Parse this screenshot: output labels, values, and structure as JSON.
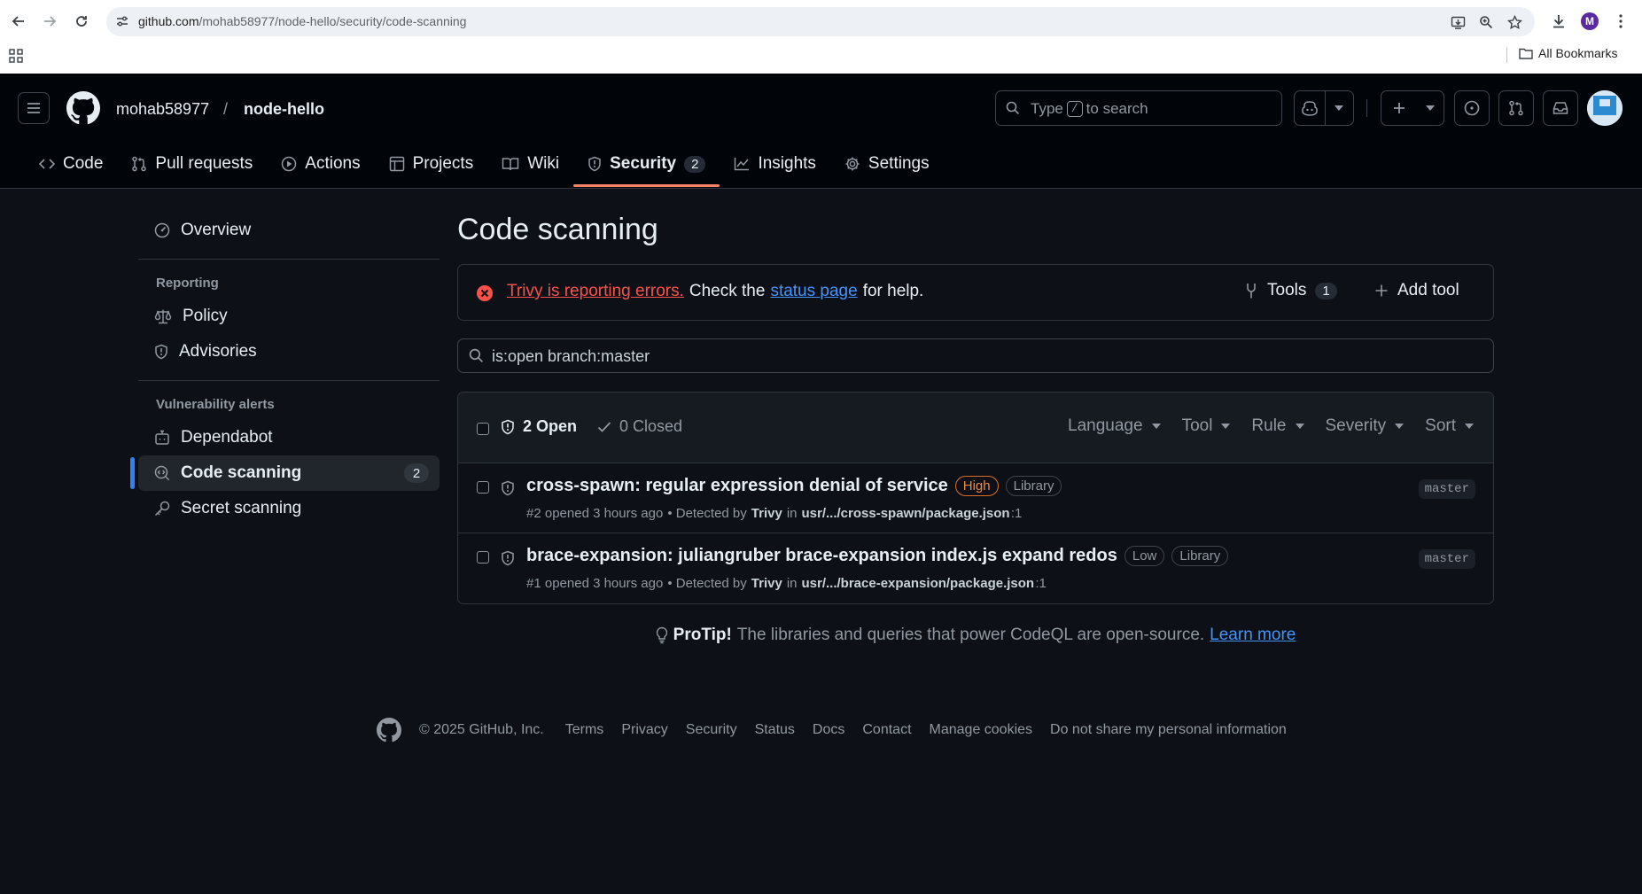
{
  "browser": {
    "url_host": "github.com",
    "url_path": "/mohab58977/node-hello/security/code-scanning",
    "profile_initial": "M",
    "bookmarks_label": "All Bookmarks"
  },
  "header": {
    "owner": "mohab58977",
    "separator": "/",
    "repo": "node-hello",
    "search_type": "Type",
    "search_key": "/",
    "search_suffix": "to search"
  },
  "repo_nav": {
    "tabs": [
      {
        "label": "Code",
        "icon": "code-icon"
      },
      {
        "label": "Pull requests",
        "icon": "git-pull-request-icon"
      },
      {
        "label": "Actions",
        "icon": "play-icon"
      },
      {
        "label": "Projects",
        "icon": "table-icon"
      },
      {
        "label": "Wiki",
        "icon": "book-icon"
      },
      {
        "label": "Security",
        "icon": "shield-icon",
        "counter": "2",
        "active": true
      },
      {
        "label": "Insights",
        "icon": "graph-icon"
      },
      {
        "label": "Settings",
        "icon": "gear-icon"
      }
    ]
  },
  "sidebar": {
    "overview": "Overview",
    "reporting_heading": "Reporting",
    "policy": "Policy",
    "advisories": "Advisories",
    "vuln_heading": "Vulnerability alerts",
    "dependabot": "Dependabot",
    "code_scanning": "Code scanning",
    "code_scanning_count": "2",
    "secret_scanning": "Secret scanning"
  },
  "main": {
    "title": "Code scanning",
    "banner": {
      "error_link": "Trivy is reporting errors.",
      "check_text": "Check the",
      "status_link": "status page",
      "help_text": "for help.",
      "tools_label": "Tools",
      "tools_count": "1",
      "add_tool_label": "Add tool"
    },
    "filter_value": "is:open branch:master",
    "open_label": "2 Open",
    "closed_label": "0 Closed",
    "filters": [
      "Language",
      "Tool",
      "Rule",
      "Severity",
      "Sort"
    ],
    "alerts": [
      {
        "title": "cross-spawn: regular expression denial of service",
        "severity": "High",
        "tag": "Library",
        "number_opened": "#2 opened 3 hours ago",
        "detected_by": "• Detected by",
        "tool": "Trivy",
        "in": "in",
        "path": "usr/.../cross-spawn/package.json",
        "line": ":1",
        "branch": "master"
      },
      {
        "title": "brace-expansion: juliangruber brace-expansion index.js expand redos",
        "severity": "Low",
        "tag": "Library",
        "number_opened": "#1 opened 3 hours ago",
        "detected_by": "• Detected by",
        "tool": "Trivy",
        "in": "in",
        "path": "usr/.../brace-expansion/package.json",
        "line": ":1",
        "branch": "master"
      }
    ],
    "protip": {
      "bold": "ProTip!",
      "text": "The libraries and queries that power CodeQL are open-source.",
      "link": "Learn more"
    }
  },
  "footer": {
    "copyright": "© 2025 GitHub, Inc.",
    "links": [
      "Terms",
      "Privacy",
      "Security",
      "Status",
      "Docs",
      "Contact",
      "Manage cookies",
      "Do not share my personal information"
    ]
  },
  "colors": {
    "background": "#0d1117",
    "header_bg": "#010409",
    "active_tab_underline": "#f78166",
    "accent_blue": "#2f81f7",
    "error_red": "#f85149",
    "high_severity": "#f0883e"
  }
}
